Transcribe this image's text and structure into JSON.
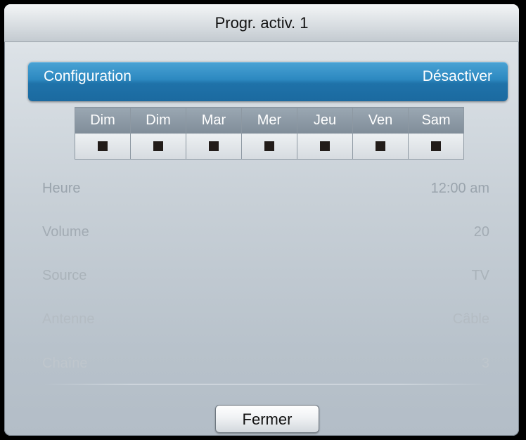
{
  "dialog": {
    "title": "Progr. activ. 1",
    "configuration": {
      "label": "Configuration",
      "value": "Désactiver"
    },
    "days": [
      {
        "label": "Dim"
      },
      {
        "label": "Dim"
      },
      {
        "label": "Mar"
      },
      {
        "label": "Mer"
      },
      {
        "label": "Jeu"
      },
      {
        "label": "Ven"
      },
      {
        "label": "Sam"
      }
    ],
    "fields": [
      {
        "label": "Heure",
        "value": "12:00 am",
        "color": "#9aa4ad"
      },
      {
        "label": "Volume",
        "value": "20",
        "color": "#a2abb3"
      },
      {
        "label": "Source",
        "value": "TV",
        "color": "#aab3ba"
      },
      {
        "label": "Antenne",
        "value": "Câble",
        "color": "#b4bcc3"
      },
      {
        "label": "Chaîne",
        "value": "3",
        "color": "#bfc6cc"
      }
    ],
    "close_label": "Fermer",
    "colors": {
      "highlight": "#2c88c0",
      "checkbox": "#221c19",
      "day_header": "#8c99a5"
    }
  }
}
